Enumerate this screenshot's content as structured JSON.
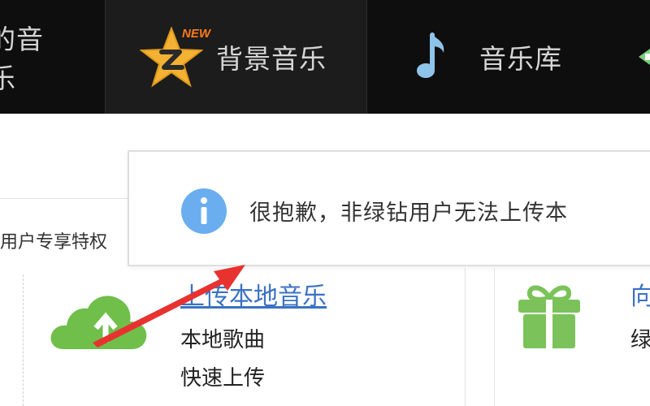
{
  "nav": {
    "items": [
      {
        "label": "的音乐"
      },
      {
        "label": "背景音乐",
        "badge": "NEW"
      },
      {
        "label": "音乐库"
      }
    ]
  },
  "toast": {
    "message": "很抱歉，非绿钻用户无法上传本"
  },
  "panel": {
    "subtitle": "用户专享特权",
    "upload_card": {
      "link": "上传本地音乐",
      "desc_line1": "本地歌曲",
      "desc_line2": "快速上传"
    },
    "gift_card": {
      "title": "向",
      "desc": "绿"
    }
  },
  "colors": {
    "nav_bg": "#0e0e0e",
    "accent_green": "#6fbf4a",
    "link_blue": "#3a72c4",
    "info_blue": "#6aaef0",
    "arrow_red": "#e8322f",
    "star_gold": "#f3b233"
  },
  "icons": {
    "star": "qq-star-icon",
    "note": "music-note-icon",
    "info": "info-icon",
    "cloud": "cloud-upload-icon",
    "gift": "gift-icon"
  }
}
